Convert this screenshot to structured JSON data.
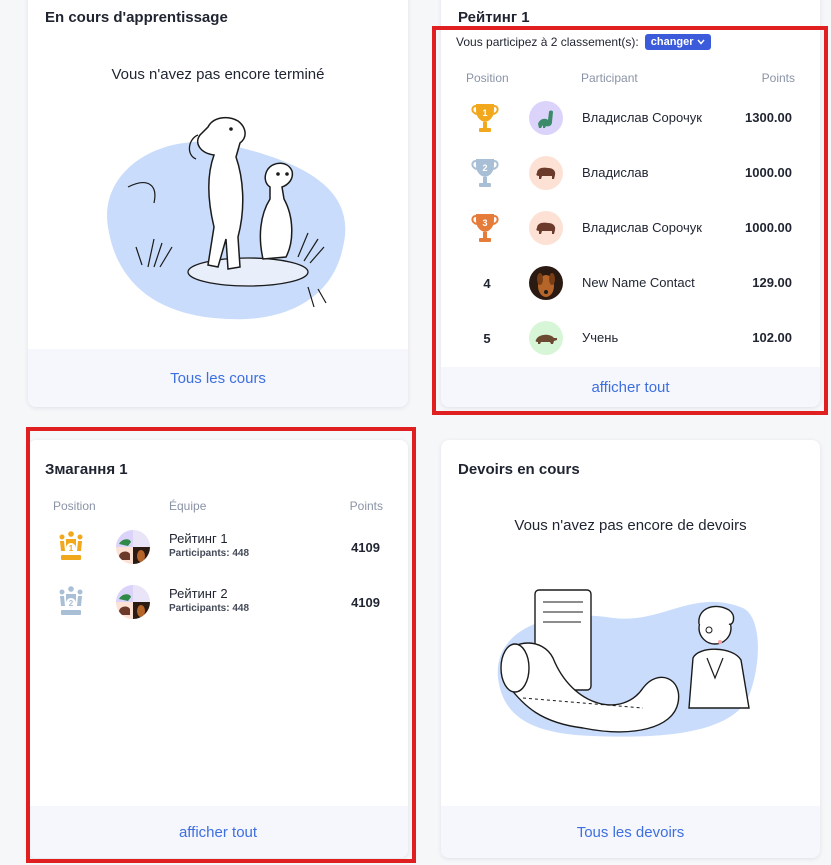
{
  "learning_card": {
    "title": "En cours d'apprentissage",
    "empty_message": "Vous n'avez pas encore terminé",
    "footer_link": "Tous les cours"
  },
  "rating_card": {
    "title": "Рейтинг 1",
    "participating_text": "Vous participez à 2 classement(s):",
    "change_button": "changer",
    "headers": {
      "position": "Position",
      "participant": "Participant",
      "points": "Points"
    },
    "rows": [
      {
        "position": "1",
        "name": "Владислав Сорочук",
        "points": "1300.00",
        "avatar": "dinosaur-avatar"
      },
      {
        "position": "2",
        "name": "Владислав",
        "points": "1000.00",
        "avatar": "bison-avatar"
      },
      {
        "position": "3",
        "name": "Владислав Сорочук",
        "points": "1000.00",
        "avatar": "bison-avatar"
      },
      {
        "position": "4",
        "name": "New Name Contact",
        "points": "129.00",
        "avatar": "dog-photo-avatar"
      },
      {
        "position": "5",
        "name": "Учень",
        "points": "102.00",
        "avatar": "turtle-avatar"
      }
    ],
    "footer_link": "afficher tout"
  },
  "competition_card": {
    "title": "Змагання 1",
    "headers": {
      "position": "Position",
      "team": "Équipe",
      "points": "Points"
    },
    "rows": [
      {
        "position": "1",
        "team": "Рейтинг 1",
        "participants": "Participants: 448",
        "points": "4109"
      },
      {
        "position": "2",
        "team": "Рейтинг 2",
        "participants": "Participants: 448",
        "points": "4109"
      }
    ],
    "footer_link": "afficher tout"
  },
  "homework_card": {
    "title": "Devoirs en cours",
    "empty_message": "Vous n'avez pas encore de devoirs",
    "footer_link": "Tous les devoirs"
  },
  "colors": {
    "accent": "#3d6fe0",
    "highlight": "#e02020",
    "gold": "#f2a81d",
    "silver": "#a9bfd6",
    "bronze": "#e57c3a"
  }
}
